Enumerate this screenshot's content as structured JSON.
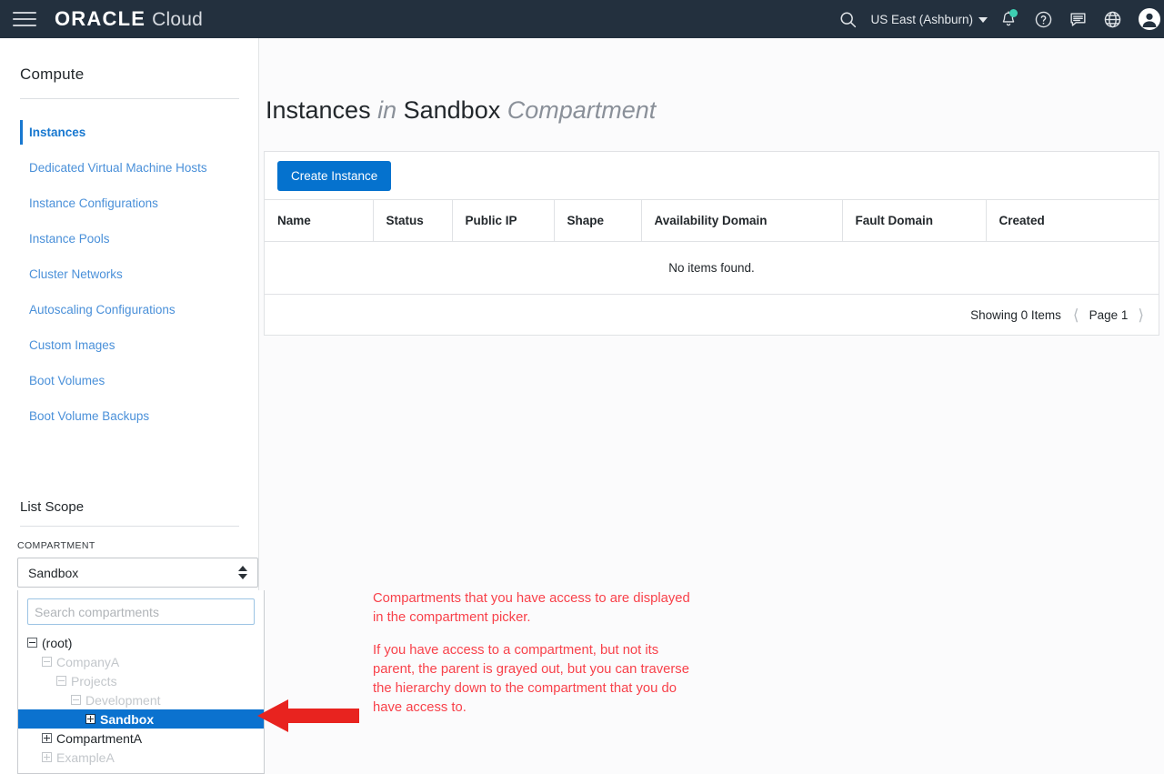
{
  "header": {
    "menu_icon": "hamburger-icon",
    "brand_primary": "ORACLE",
    "brand_secondary": "Cloud",
    "search_icon": "search-icon",
    "region": "US East (Ashburn)",
    "notifications_icon": "bell-icon",
    "help_icon": "help-icon",
    "feedback_icon": "chat-icon",
    "language_icon": "globe-icon",
    "profile_icon": "avatar-icon",
    "notification_dot_color": "#3ecfb2"
  },
  "sidebar": {
    "title": "Compute",
    "items": [
      {
        "label": "Instances",
        "active": true
      },
      {
        "label": "Dedicated Virtual Machine Hosts",
        "active": false
      },
      {
        "label": "Instance Configurations",
        "active": false
      },
      {
        "label": "Instance Pools",
        "active": false
      },
      {
        "label": "Cluster Networks",
        "active": false
      },
      {
        "label": "Autoscaling Configurations",
        "active": false
      },
      {
        "label": "Custom Images",
        "active": false
      },
      {
        "label": "Boot Volumes",
        "active": false
      },
      {
        "label": "Boot Volume Backups",
        "active": false
      }
    ],
    "accent_color": "#1878d0"
  },
  "list_scope": {
    "title": "List Scope",
    "compartment_label": "COMPARTMENT",
    "selected_compartment": "Sandbox",
    "search_placeholder": "Search compartments",
    "search_value": "",
    "tree": [
      {
        "label": "(root)",
        "indent": 0,
        "toggle": "minus",
        "state": "normal"
      },
      {
        "label": "CompanyA",
        "indent": 1,
        "toggle": "minus",
        "state": "dimmed"
      },
      {
        "label": "Projects",
        "indent": 2,
        "toggle": "minus",
        "state": "dimmed"
      },
      {
        "label": "Development",
        "indent": 3,
        "toggle": "minus",
        "state": "dimmed"
      },
      {
        "label": "Sandbox",
        "indent": 4,
        "toggle": "plus",
        "state": "selected"
      },
      {
        "label": "CompartmentA",
        "indent": 1,
        "toggle": "plus",
        "state": "normal"
      },
      {
        "label": "ExampleA",
        "indent": 1,
        "toggle": "plus",
        "state": "dimmed"
      }
    ],
    "selected_row_color": "#0b72cf"
  },
  "main": {
    "title_part1": "Instances",
    "title_part2": "in",
    "title_part3": "Sandbox",
    "title_part4": "Compartment",
    "create_button": "Create Instance",
    "create_button_color": "#0572ce",
    "table": {
      "columns": [
        "Name",
        "Status",
        "Public IP",
        "Shape",
        "Availability Domain",
        "Fault Domain",
        "Created"
      ],
      "rows": [],
      "empty_message": "No items found."
    },
    "footer": {
      "showing": "Showing 0 Items",
      "prev_icon": "chevron-left-icon",
      "page_label": "Page 1",
      "next_icon": "chevron-right-icon"
    }
  },
  "annotation": {
    "color": "#f8414a",
    "paragraph1": "Compartments that you have access to are displayed in the compartment picker.",
    "paragraph2": "If you have access to a compartment, but not its parent, the parent is grayed out, but you can traverse the hierarchy down to the compartment that you do have access to.",
    "arrow": "arrow-left-pointer"
  }
}
